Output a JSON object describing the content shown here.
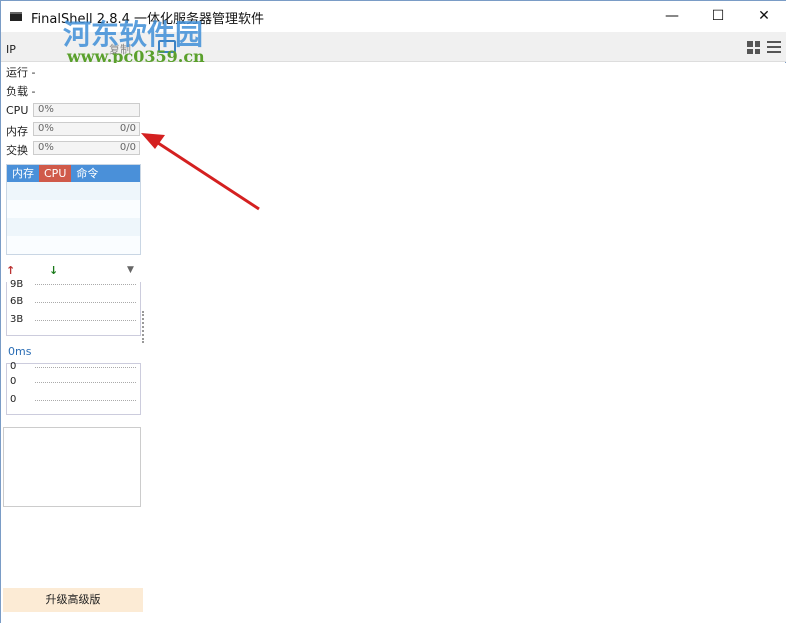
{
  "window": {
    "title": "FinalShell 2.8.4 一体化服务器管理软件",
    "minimize": "—",
    "maximize": "☐",
    "close": "✕"
  },
  "toolbar": {
    "copy": "复制"
  },
  "sidebar": {
    "ip": "IP",
    "running": "运行 -",
    "load": "负载 -",
    "cpu": {
      "label": "CPU",
      "value": "0%"
    },
    "mem": {
      "label": "内存",
      "value": "0%",
      "ratio": "0/0"
    },
    "swap": {
      "label": "交换",
      "value": "0%",
      "ratio": "0/0"
    },
    "tabs": [
      "内存",
      "CPU",
      "命令"
    ],
    "net": {
      "ticks": [
        "9B",
        "6B",
        "3B"
      ]
    },
    "latency": {
      "title": "0ms",
      "ticks": [
        "0",
        "0",
        "0"
      ]
    },
    "upgrade": "升级高级版"
  },
  "watermark": {
    "name": "河东软件园",
    "url": "www.pc0359.cn"
  },
  "colors": {
    "accent": "#4a90d9",
    "active_tab": "#d05a4a",
    "arrow": "#d42020"
  }
}
